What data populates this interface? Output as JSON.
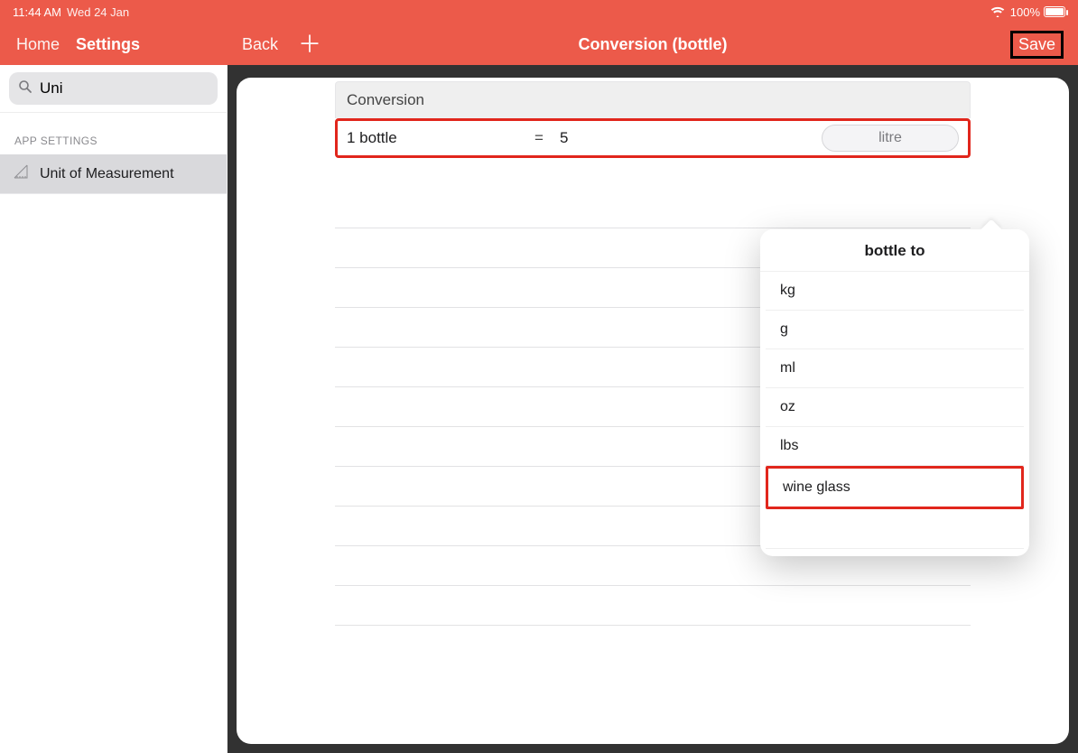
{
  "statusbar": {
    "time": "11:44 AM",
    "date": "Wed 24 Jan",
    "battery_pct": "100%"
  },
  "nav": {
    "home": "Home",
    "settings": "Settings",
    "back": "Back",
    "title": "Conversion (bottle)",
    "save": "Save"
  },
  "search": {
    "value": "Uni"
  },
  "sidebar": {
    "section_header": "APP SETTINGS",
    "item": "Unit of Measurement"
  },
  "conversion": {
    "card_title": "Conversion",
    "from_unit": "1 bottle",
    "equals": "=",
    "value": "5",
    "target_unit": "litre"
  },
  "popover": {
    "title": "bottle to",
    "items": [
      "kg",
      "g",
      "ml",
      "oz",
      "lbs",
      "wine glass"
    ],
    "highlighted_index": 5
  }
}
